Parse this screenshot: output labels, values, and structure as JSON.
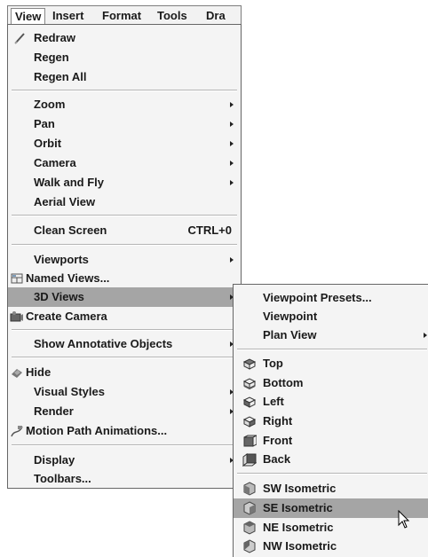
{
  "menubar": {
    "items": [
      "View",
      "Insert",
      "Format",
      "Tools",
      "Dra"
    ]
  },
  "view_menu": {
    "redraw": "Redraw",
    "regen": "Regen",
    "regen_all": "Regen All",
    "zoom": "Zoom",
    "pan": "Pan",
    "orbit": "Orbit",
    "camera": "Camera",
    "walk_and_fly": "Walk and Fly",
    "aerial_view": "Aerial View",
    "clean_screen": "Clean Screen",
    "clean_screen_shortcut": "CTRL+0",
    "viewports": "Viewports",
    "named_views": "Named Views...",
    "views_3d": "3D Views",
    "create_camera": "Create Camera",
    "show_annotative": "Show Annotative Objects",
    "hide": "Hide",
    "visual_styles": "Visual Styles",
    "render": "Render",
    "motion_path": "Motion Path Animations...",
    "display": "Display",
    "toolbars": "Toolbars..."
  },
  "views3d_menu": {
    "viewpoint_presets": "Viewpoint Presets...",
    "viewpoint": "Viewpoint",
    "plan_view": "Plan View",
    "top": "Top",
    "bottom": "Bottom",
    "left": "Left",
    "right": "Right",
    "front": "Front",
    "back": "Back",
    "sw_isometric": "SW Isometric",
    "se_isometric": "SE Isometric",
    "ne_isometric": "NE Isometric",
    "nw_isometric": "NW Isometric"
  },
  "colors": {
    "highlight": "#a5a5a5",
    "menu_bg": "#f4f4f4"
  }
}
